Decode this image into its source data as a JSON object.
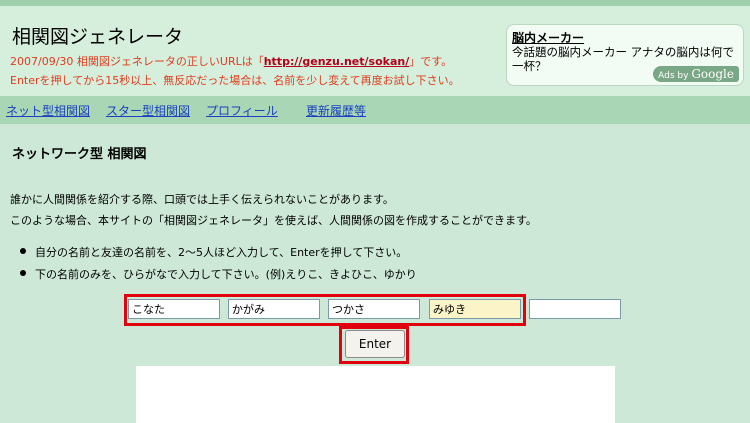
{
  "header": {
    "title": "相関図ジェネレータ",
    "notice_line1_prefix": "2007/09/30 相関図ジェネレータの正しいURLは「",
    "notice_url": "http://genzu.net/sokan/",
    "notice_line1_suffix": "」です。",
    "notice_line2": "Enterを押してから15秒以上、無反応だった場合は、名前を少し変えて再度お試し下さい。"
  },
  "ad": {
    "title": "脳内メーカー",
    "text": "今話題の脳内メーカー アナタの脳内は何で一杯？",
    "badge_prefix": "Ads by",
    "badge_brand": "Google"
  },
  "nav": {
    "items": [
      "ネット型相関図",
      "スター型相関図",
      "プロフィール",
      "更新履歴等"
    ]
  },
  "main": {
    "title": "ネットワーク型  相関図",
    "intro1": "誰かに人間関係を紹介する際、口頭では上手く伝えられないことがあります。",
    "intro2": "このような場合、本サイトの「相関図ジェネレータ」を使えば、人間関係の図を作成することができます。",
    "bullets": [
      "自分の名前と友達の名前を、2〜5人ほど入力して、Enterを押して下さい。",
      "下の名前のみを、ひらがなで入力して下さい。(例)えりこ、きよひこ、ゆかり"
    ]
  },
  "form": {
    "names": [
      "こなた",
      "かがみ",
      "つかさ",
      "みゆき",
      ""
    ],
    "enter_label": "Enter"
  }
}
